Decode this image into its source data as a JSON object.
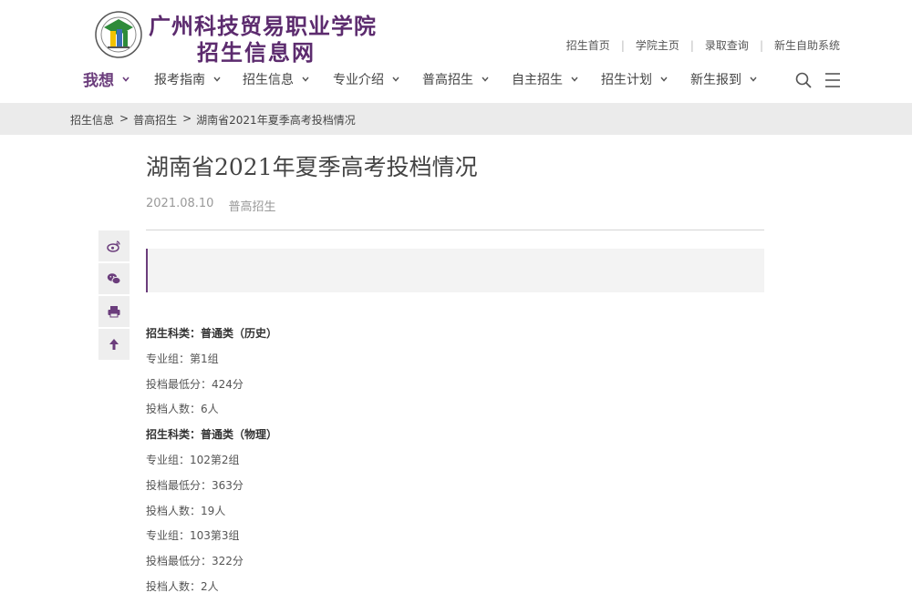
{
  "header": {
    "school_name": "广州科技贸易职业学院",
    "site_name": "招生信息网",
    "top_links": [
      "招生首页",
      "学院主页",
      "录取查询",
      "新生自助系统"
    ]
  },
  "nav": {
    "main_label": "我想",
    "items": [
      "报考指南",
      "招生信息",
      "专业介绍",
      "普高招生",
      "自主招生",
      "招生计划",
      "新生报到"
    ]
  },
  "breadcrumb": [
    "招生信息",
    "普高招生",
    "湖南省2021年夏季高考投档情况"
  ],
  "article": {
    "title": "湖南省2021年夏季高考投档情况",
    "date": "2021.08.10",
    "category": "普高招生",
    "lines": [
      {
        "text": "招生科类：普通类（历史）",
        "bold": true
      },
      {
        "text": "专业组：第1组",
        "bold": false
      },
      {
        "text": "投档最低分：424分",
        "bold": false
      },
      {
        "text": "投档人数：6人",
        "bold": false
      },
      {
        "text": "招生科类：普通类（物理）",
        "bold": true
      },
      {
        "text": "专业组：102第2组",
        "bold": false
      },
      {
        "text": "投档最低分：363分",
        "bold": false
      },
      {
        "text": "投档人数：19人",
        "bold": false
      },
      {
        "text": "专业组：103第3组",
        "bold": false
      },
      {
        "text": "投档最低分：322分",
        "bold": false
      },
      {
        "text": "投档人数：2人",
        "bold": false
      }
    ]
  },
  "share_icons": [
    "weibo-icon",
    "wechat-icon",
    "print-icon",
    "back-to-top-icon"
  ],
  "colors": {
    "brand": "#5c2b6e",
    "accent": "#6b3d7c",
    "crumb_bg": "#ebebeb",
    "summary_bg": "#f3f3f3"
  }
}
